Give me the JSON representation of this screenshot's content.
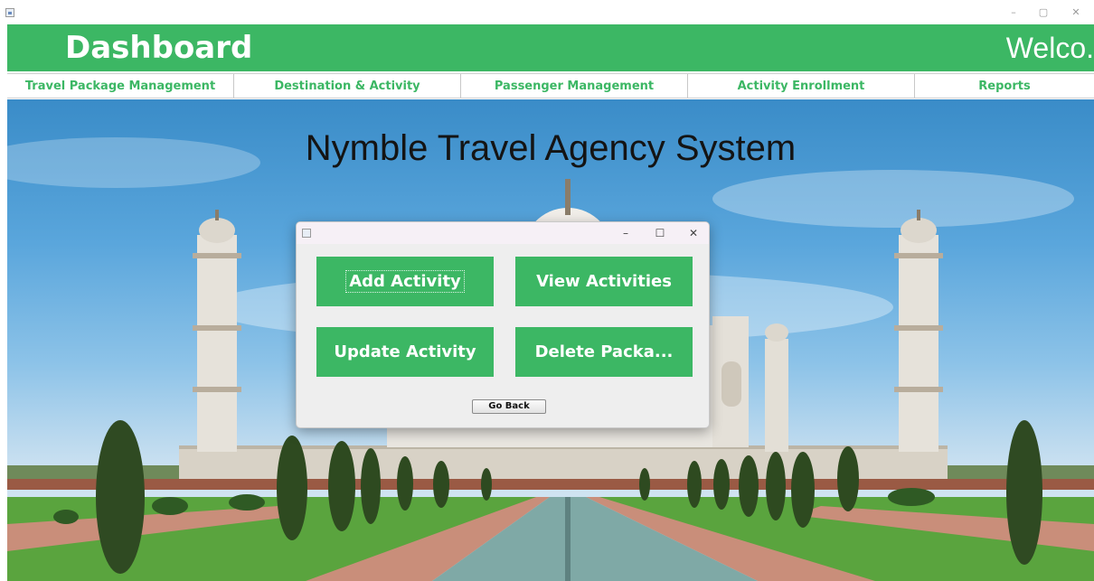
{
  "titlebar": {
    "minimize_glyph": "–",
    "maximize_glyph": "▢",
    "close_glyph": "✕"
  },
  "header": {
    "title": "Dashboard",
    "welcome": "Welco."
  },
  "menu": {
    "items": [
      {
        "label": "Travel Package Management"
      },
      {
        "label": "Destination & Activity"
      },
      {
        "label": "Passenger Management"
      },
      {
        "label": "Activity Enrollment"
      },
      {
        "label": "Reports"
      }
    ]
  },
  "main": {
    "title": "Nymble Travel Agency System"
  },
  "dialog": {
    "minimize_glyph": "–",
    "maximize_glyph": "☐",
    "close_glyph": "✕",
    "add_label": "Add Activity",
    "view_label": "View Activities",
    "update_label": "Update Activity",
    "delete_label": "Delete Packa...",
    "back_label": "Go Back"
  },
  "colors": {
    "accent": "#3cb764",
    "menu_text": "#3cb764",
    "dialog_bg": "#eeeeee"
  },
  "icons": {
    "app": "java-cup-icon",
    "scene": "taj-mahal-background-image"
  }
}
